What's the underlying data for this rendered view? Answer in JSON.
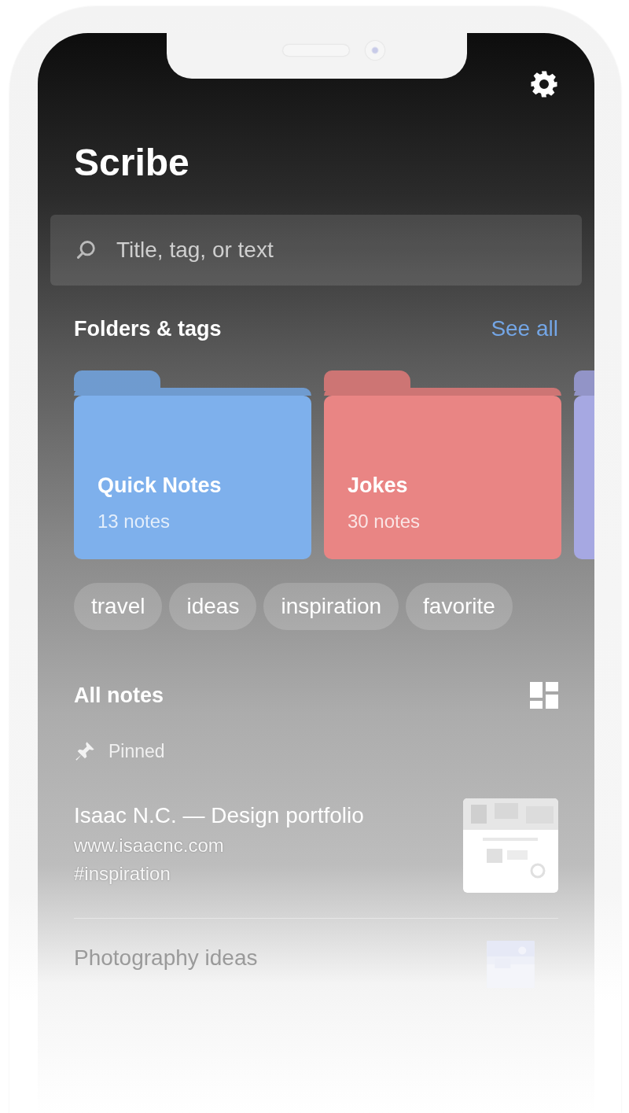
{
  "app": {
    "title": "Scribe"
  },
  "search": {
    "placeholder": "Title, tag, or text"
  },
  "folders_section": {
    "title": "Folders & tags",
    "action": "See all"
  },
  "folders": [
    {
      "name": "Quick Notes",
      "count": "13 notes",
      "color": "#7eb0ec"
    },
    {
      "name": "Jokes",
      "count": "30 notes",
      "color": "#e98584"
    },
    {
      "color": "#a6a8e2"
    }
  ],
  "tags": [
    "travel",
    "ideas",
    "inspiration",
    "favorite"
  ],
  "notes_section": {
    "title": "All notes",
    "pinned_label": "Pinned"
  },
  "notes": [
    {
      "title": "Isaac N.C. — Design portfolio",
      "url": "www.isaacnc.com",
      "tag": "#inspiration",
      "kind": "link"
    },
    {
      "title": "Photography ideas"
    }
  ]
}
